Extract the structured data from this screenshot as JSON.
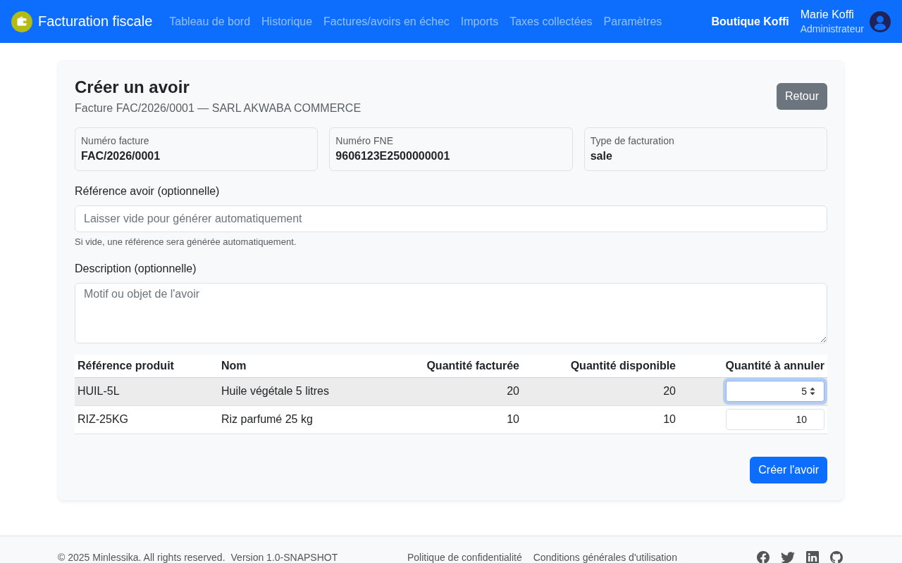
{
  "navbar": {
    "brand": "Facturation fiscale",
    "links": [
      {
        "label": "Tableau de bord",
        "selected": false
      },
      {
        "label": "Historique",
        "selected": false
      },
      {
        "label": "Factures/avoirs en échec",
        "selected": false
      },
      {
        "label": "Imports",
        "selected": false
      },
      {
        "label": "Taxes collectées",
        "selected": false
      },
      {
        "label": "Paramètres",
        "selected": false
      }
    ],
    "company": "Boutique Koffi",
    "user": {
      "name": "Marie Koffi",
      "role": "Administrateur"
    }
  },
  "credit_note_form": {
    "title": "Créer un avoir",
    "subtitle": "Facture FAC/2026/0001 — SARL AKWABA COMMERCE",
    "back_button": "Retour",
    "info_cards": [
      {
        "label": "Numéro facture",
        "value": "FAC/2026/0001"
      },
      {
        "label": "Numéro FNE",
        "value": "9606123E2500000001"
      },
      {
        "label": "Type de facturation",
        "value": "sale"
      }
    ],
    "fields": [
      {
        "kind": "input",
        "label": "Référence avoir (optionnelle)",
        "placeholder": "Laisser vide pour générer automatiquement",
        "help": "Si vide, une référence sera générée automatiquement."
      },
      {
        "kind": "textarea",
        "label": "Description (optionnelle)",
        "placeholder": "Motif ou objet de l'avoir"
      }
    ],
    "table": {
      "columns": [
        "Référence produit",
        "Nom",
        "Quantité facturée",
        "Quantité disponible",
        "Quantité à annuler"
      ],
      "rows": [
        {
          "cells": [
            "HUIL-5L",
            "Huile végétale 5 litres",
            "20",
            "20"
          ],
          "quantity": "5",
          "selected": true,
          "focused": true
        },
        {
          "cells": [
            "RIZ-25KG",
            "Riz parfumé 25 kg",
            "10",
            "10"
          ],
          "quantity": "10",
          "selected": false,
          "focused": false
        }
      ]
    },
    "submit_button": "Créer l'avoir"
  },
  "footer": {
    "copyright": "© 2025 Minlessika. All rights reserved.",
    "version": "Version 1.0-SNAPSHOT",
    "links": [
      "Politique de confidentialité",
      "Conditions générales d'utilisation"
    ]
  }
}
